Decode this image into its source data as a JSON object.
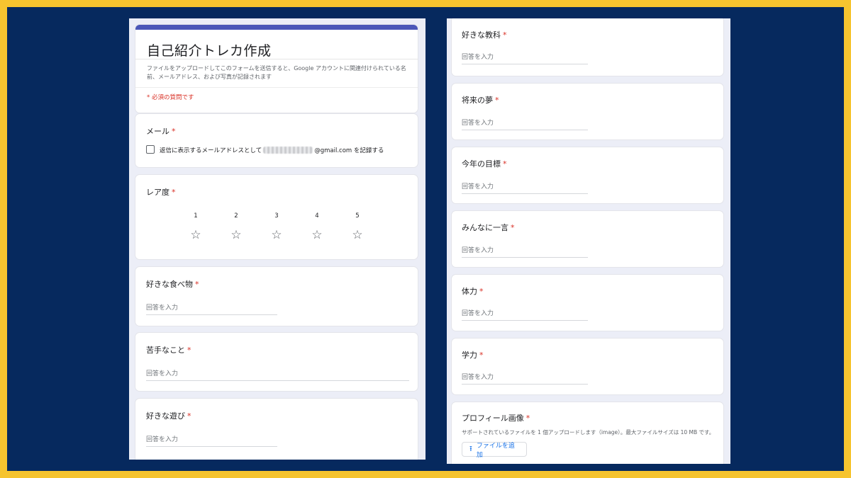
{
  "form": {
    "title": "自己紹介トレカ作成",
    "description": "ファイルをアップロードしてこのフォームを送信すると、Google アカウントに関連付けられている名前、メールアドレス、および写真が記録されます",
    "required_note": "* 必須の質問です"
  },
  "required_mark": "*",
  "email": {
    "label": "メール",
    "checkbox_prefix": "返信に表示するメールアドレスとして",
    "checkbox_suffix": "@gmail.com を記録する"
  },
  "rarity": {
    "label": "レア度",
    "scale": [
      "1",
      "2",
      "3",
      "4",
      "5"
    ],
    "star_glyph": "☆"
  },
  "answer_placeholder": "回答を入力",
  "left_questions": [
    "好きな食べ物",
    "苦手なこと",
    "好きな遊び"
  ],
  "right_questions": [
    "好きな教科",
    "将来の夢",
    "今年の目標",
    "みんなに一言",
    "体力",
    "学力"
  ],
  "profile_image": {
    "label": "プロフィール画像",
    "hint": "サポートされているファイルを 1 個アップロードします（image）。最大ファイルサイズは 10 MB です。",
    "button_label": "ファイルを追加"
  },
  "colors": {
    "accent": "#4b57b8",
    "required": "#d93025",
    "link": "#1a73e8",
    "outer_border": "#f6c42f",
    "backdrop": "#06295e"
  }
}
